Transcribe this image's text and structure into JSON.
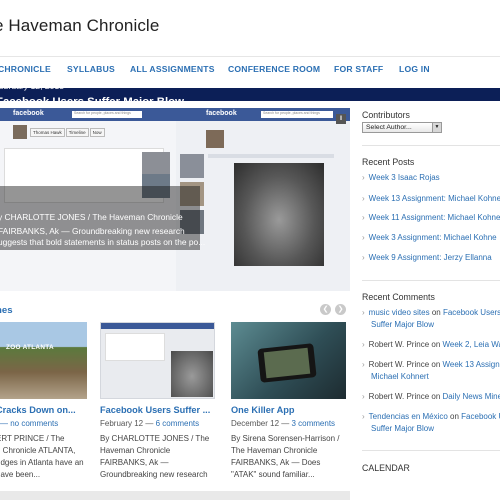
{
  "site": {
    "title": "e Haveman Chronicle"
  },
  "nav": {
    "items": [
      "CHRONICLE",
      "SYLLABUS",
      "ALL ASSIGNMENTS",
      "CONFERENCE ROOM",
      "FOR STAFF",
      "LOG IN"
    ]
  },
  "colors": {
    "link": "#2b6fb3",
    "nav_band": "#0c1f57",
    "facebook": "#3b5998"
  },
  "slider": {
    "date": "ebruary 12, 2013",
    "title": "Facebook Users Suffer Major Blow",
    "lines": [
      "y CHARLOTTE JONES / The Haveman Chronicle",
      "FAIRBANKS, Ak  —  Groundbreaking new research",
      "uggests that bold statements in status posts on the po..."
    ],
    "screenshot": {
      "logo": "facebook",
      "search_placeholder": "Search for people, places and things",
      "tabs": [
        "Thomas Hawk",
        "Timeline",
        "Now"
      ]
    }
  },
  "headlines": {
    "label": "nes",
    "prev_icon": "chevron-left-icon",
    "next_icon": "chevron-right-icon",
    "cards": [
      {
        "title": " Cracks Down on...",
        "meta_date": "",
        "meta_comments": "— no comments",
        "lines": [
          "ERT PRINCE / The",
          "n Chronicle ATLANTA,",
          "udges in Atlanta have an",
          "have been..."
        ],
        "image_caption": "ZOO ATLANTA"
      },
      {
        "title": "Facebook Users Suffer ...",
        "meta_date": "February 12  — ",
        "meta_comments": "6 comments",
        "lines": [
          "By CHARLOTTE JONES / The",
          "Haveman Chronicle",
          "FAIRBANKS, Ak  —",
          "Groundbreaking new research"
        ]
      },
      {
        "title": "One Killer App",
        "meta_date": "December 12  — ",
        "meta_comments": "3 comments",
        "lines": [
          "By Sirena Sorensen-Harrison /",
          "The Haveman Chronicle",
          "FAIRBANKS, Ak  —  Does",
          "\"ATAK\" sound familiar..."
        ]
      }
    ]
  },
  "sidebar": {
    "contributors": {
      "heading": "Contributors",
      "select_value": "Select Author..."
    },
    "recent_posts": {
      "heading": "Recent Posts",
      "items": [
        "Week 3 Isaac Rojas",
        "Week 13 Assignment: Michael Kohne",
        "Week 11 Assignment: Michael Kohne",
        "Week 3 Assignment: Michael Kohne",
        "Week 9 Assignment: Jerzy Ellanna"
      ]
    },
    "recent_comments": {
      "heading": "Recent Comments",
      "items": [
        {
          "author": "music video sites",
          "on": " on ",
          "post": "Facebook Users",
          "post2": "Suffer Major Blow"
        },
        {
          "author": "Robert W. Prince",
          "on": " on ",
          "post": "Week 2, Leia Wa",
          "post2": ""
        },
        {
          "author": "Robert W. Prince",
          "on": " on ",
          "post": "Week 13 Assign",
          "post2": "Michael Kohnert"
        },
        {
          "author": "Robert W. Prince",
          "on": " on ",
          "post": "Daily News Mine",
          "post2": ""
        },
        {
          "author": "Tendencias en México",
          "on": " on ",
          "post": "Facebook U",
          "post2": "Suffer Major Blow"
        }
      ]
    },
    "calendar": {
      "heading": "CALENDAR"
    }
  }
}
